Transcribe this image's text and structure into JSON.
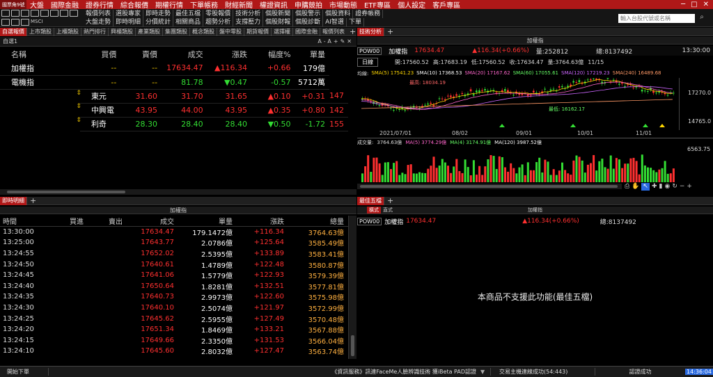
{
  "app": {
    "logo": "國票角9號",
    "menus": [
      "大盤",
      "國際金融",
      "證券行情",
      "綜合報價",
      "期權行情",
      "下單帳務",
      "財經新聞",
      "權證資訊",
      "申購競拍",
      "市場動態",
      "ETF專區",
      "個人設定",
      "客戶專區"
    ]
  },
  "toolbar": {
    "icon_label": "MSCI",
    "row1": [
      "報價列表",
      "選股專家",
      "即時走勢",
      "最佳五檔",
      "零股報價",
      "技術分析",
      "個股新聞",
      "個股警示",
      "個股資料",
      "證券帳務"
    ],
    "row2": [
      "大盤走勢",
      "即時明細",
      "分價統計",
      "相關商品",
      "趨勢分析",
      "支撐壓力",
      "個股財報",
      "個股診斷",
      "AI智選",
      "下單"
    ],
    "search_placeholder": "輸入台股代號或名稱"
  },
  "quote_panel": {
    "tabs": [
      "自選報價",
      "上市類股",
      "上櫃類股",
      "熱門排行",
      "興櫃類股",
      "產業類股",
      "集團類股",
      "概念類股",
      "盤中零股",
      "期貨報價",
      "選擇權",
      "國際金融"
    ],
    "list_tab": "報價列表",
    "list_name": "自選1",
    "columns": [
      "名稱",
      "買價",
      "賣價",
      "成交",
      "漲跌",
      "幅度%",
      "單量"
    ],
    "rows": [
      {
        "name": "加權指",
        "bid": "--",
        "ask": "--",
        "last": "17634.47",
        "chg": "▲116.34",
        "pct": "+0.66",
        "vol": "179億",
        "arrow": ""
      },
      {
        "name": "電機指",
        "bid": "--",
        "ask": "--",
        "last": "81.78",
        "chg": "▼0.47",
        "pct": "-0.57",
        "vol": "5712萬",
        "arrow": ""
      },
      {
        "name": "東元",
        "bid": "31.60",
        "ask": "31.70",
        "last": "31.65",
        "chg": "▲0.10",
        "pct": "+0.31",
        "vol": "147",
        "arrow": "⇕"
      },
      {
        "name": "中興電",
        "bid": "43.95",
        "ask": "44.00",
        "last": "43.95",
        "chg": "▲0.35",
        "pct": "+0.80",
        "vol": "142",
        "arrow": "⇕"
      },
      {
        "name": "利奇",
        "bid": "28.30",
        "ask": "28.40",
        "last": "28.40",
        "chg": "▼0.50",
        "pct": "-1.72",
        "vol": "155",
        "arrow": "⇕"
      }
    ]
  },
  "tech_panel": {
    "tab": "技術分析",
    "title": "加權指",
    "code": "POW00",
    "name": "加權指",
    "price": "17634.47",
    "chg": "▲116.34(+0.66%)",
    "qty_label": "量:252812",
    "total": "總:8137492",
    "time": "13:30:00",
    "period": "日線",
    "ohlc": {
      "open": "開:17560.52",
      "high": "高:17683.19",
      "low": "低:17560.52",
      "close": "收:17634.47",
      "vol": "量:3764.63億",
      "date": "11/15"
    },
    "sma": {
      "label": "均線:",
      "s5": "SMA(5) 17541.23",
      "s10": "SMA(10) 17368.53",
      "s20": "SMA(20) 17167.62",
      "s60": "SMA(60) 17055.61",
      "s120": "SMA(120) 17219.23",
      "s240": "SMA(240) 16489.68"
    },
    "high_label": "最高: 18034.19",
    "low_label": "最低: 16162.17",
    "price_ticks": [
      "17270.0",
      "14765.0"
    ],
    "dates": [
      "2021/07/01",
      "08/02",
      "09/01",
      "10/01",
      "11/01"
    ],
    "vol_line": {
      "label": "成交量:",
      "v": "3764.63億",
      "ma5": "MA(5) 3774.29億",
      "ma20": "MA(4) 3174.91億",
      "ma120": "MA(120) 3987.52億"
    },
    "vol_tick": "6563.75"
  },
  "tick_panel": {
    "tab": "即時明細",
    "title": "加權指",
    "columns": [
      "時間",
      "買進",
      "賣出",
      "成交",
      "單量",
      "漲跌",
      "總量"
    ],
    "rows": [
      [
        "13:30:00",
        "",
        "",
        "17634.47",
        "179.1472億",
        "+116.34",
        "3764.63億"
      ],
      [
        "13:25:00",
        "",
        "",
        "17643.77",
        "2.0786億",
        "+125.64",
        "3585.49億"
      ],
      [
        "13:24:55",
        "",
        "",
        "17652.02",
        "2.5395億",
        "+133.89",
        "3583.41億"
      ],
      [
        "13:24:50",
        "",
        "",
        "17640.61",
        "1.4789億",
        "+122.48",
        "3580.87億"
      ],
      [
        "13:24:45",
        "",
        "",
        "17641.06",
        "1.5779億",
        "+122.93",
        "3579.39億"
      ],
      [
        "13:24:40",
        "",
        "",
        "17650.64",
        "1.8281億",
        "+132.51",
        "3577.81億"
      ],
      [
        "13:24:35",
        "",
        "",
        "17640.73",
        "2.9973億",
        "+122.60",
        "3575.98億"
      ],
      [
        "13:24:30",
        "",
        "",
        "17640.10",
        "2.5074億",
        "+121.97",
        "3572.99億"
      ],
      [
        "13:24:25",
        "",
        "",
        "17645.62",
        "2.5955億",
        "+127.49",
        "3570.48億"
      ],
      [
        "13:24:20",
        "",
        "",
        "17651.34",
        "1.8469億",
        "+133.21",
        "3567.88億"
      ],
      [
        "13:24:15",
        "",
        "",
        "17649.66",
        "2.3350億",
        "+131.53",
        "3566.04億"
      ],
      [
        "13:24:10",
        "",
        "",
        "17645.60",
        "2.8032億",
        "+127.47",
        "3563.74億"
      ]
    ]
  },
  "best5_panel": {
    "tab": "最佳五檔",
    "sub1": "橫式",
    "sub2": "直式",
    "title": "加權指",
    "code": "POW00",
    "name": "加權指",
    "price": "17634.47",
    "chg": "▲116.34(+0.66%)",
    "total": "總:8137492",
    "message": "本商品不支援此功能(最佳五檔)"
  },
  "status": {
    "start": "開始下單",
    "news": "《資訊服務》訊連FaceMe人臉辨識技術 獲iBeta PAD認證",
    "conn": "交易主機連線成功(54:443)",
    "auth": "認證成功",
    "clock": "14:36:04"
  },
  "colors": {
    "menu_red": "#b01818",
    "up": "#ff3030",
    "down": "#33dd33"
  }
}
